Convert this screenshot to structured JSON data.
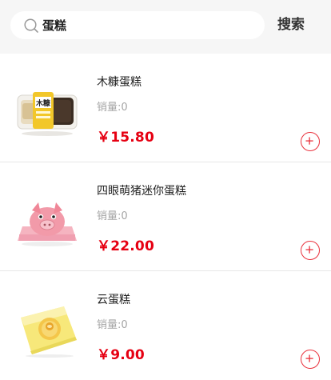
{
  "search": {
    "value": "蛋糕",
    "button_label": "搜索"
  },
  "colors": {
    "accent": "#e60012",
    "header_bg": "#f6f6f6"
  },
  "products": [
    {
      "name": "木糠蛋糕",
      "sales": "销量:0",
      "price": "￥15.80",
      "image_icon": "mukang-cake-box"
    },
    {
      "name": "四眼萌猪迷你蛋糕",
      "sales": "销量:0",
      "price": "￥22.00",
      "image_icon": "pig-cake"
    },
    {
      "name": "云蛋糕",
      "sales": "销量:0",
      "price": "￥9.00",
      "image_icon": "cloud-cake-bag"
    }
  ]
}
